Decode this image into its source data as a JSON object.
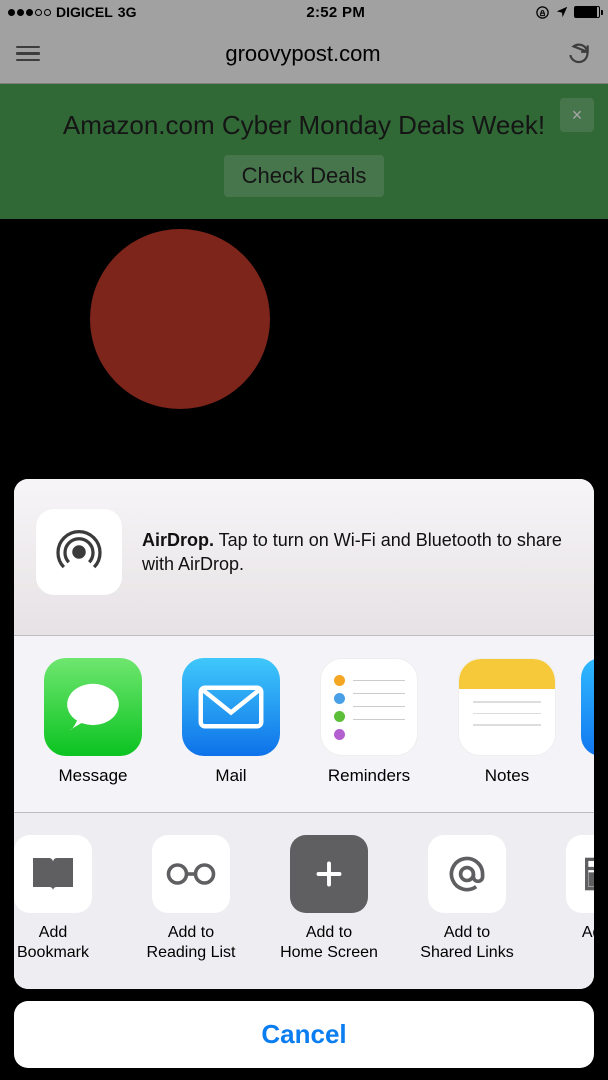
{
  "status_bar": {
    "carrier": "DIGICEL",
    "network": "3G",
    "time": "2:52 PM"
  },
  "safari": {
    "url": "groovypost.com"
  },
  "banner": {
    "title": "Amazon.com Cyber Monday Deals Week!",
    "button": "Check Deals",
    "close": "×"
  },
  "share_sheet": {
    "airdrop": {
      "title": "AirDrop.",
      "body": " Tap to turn on Wi-Fi and Bluetooth to share with AirDrop."
    },
    "apps": [
      {
        "label": "Message"
      },
      {
        "label": "Mail"
      },
      {
        "label": "Reminders"
      },
      {
        "label": "Notes"
      }
    ],
    "actions": [
      {
        "label": "Add\nBookmark"
      },
      {
        "label": "Add to\nReading List"
      },
      {
        "label": "Add to\nHome Screen"
      },
      {
        "label": "Add to\nShared Links"
      },
      {
        "label": "Add to"
      }
    ],
    "cancel": "Cancel"
  }
}
